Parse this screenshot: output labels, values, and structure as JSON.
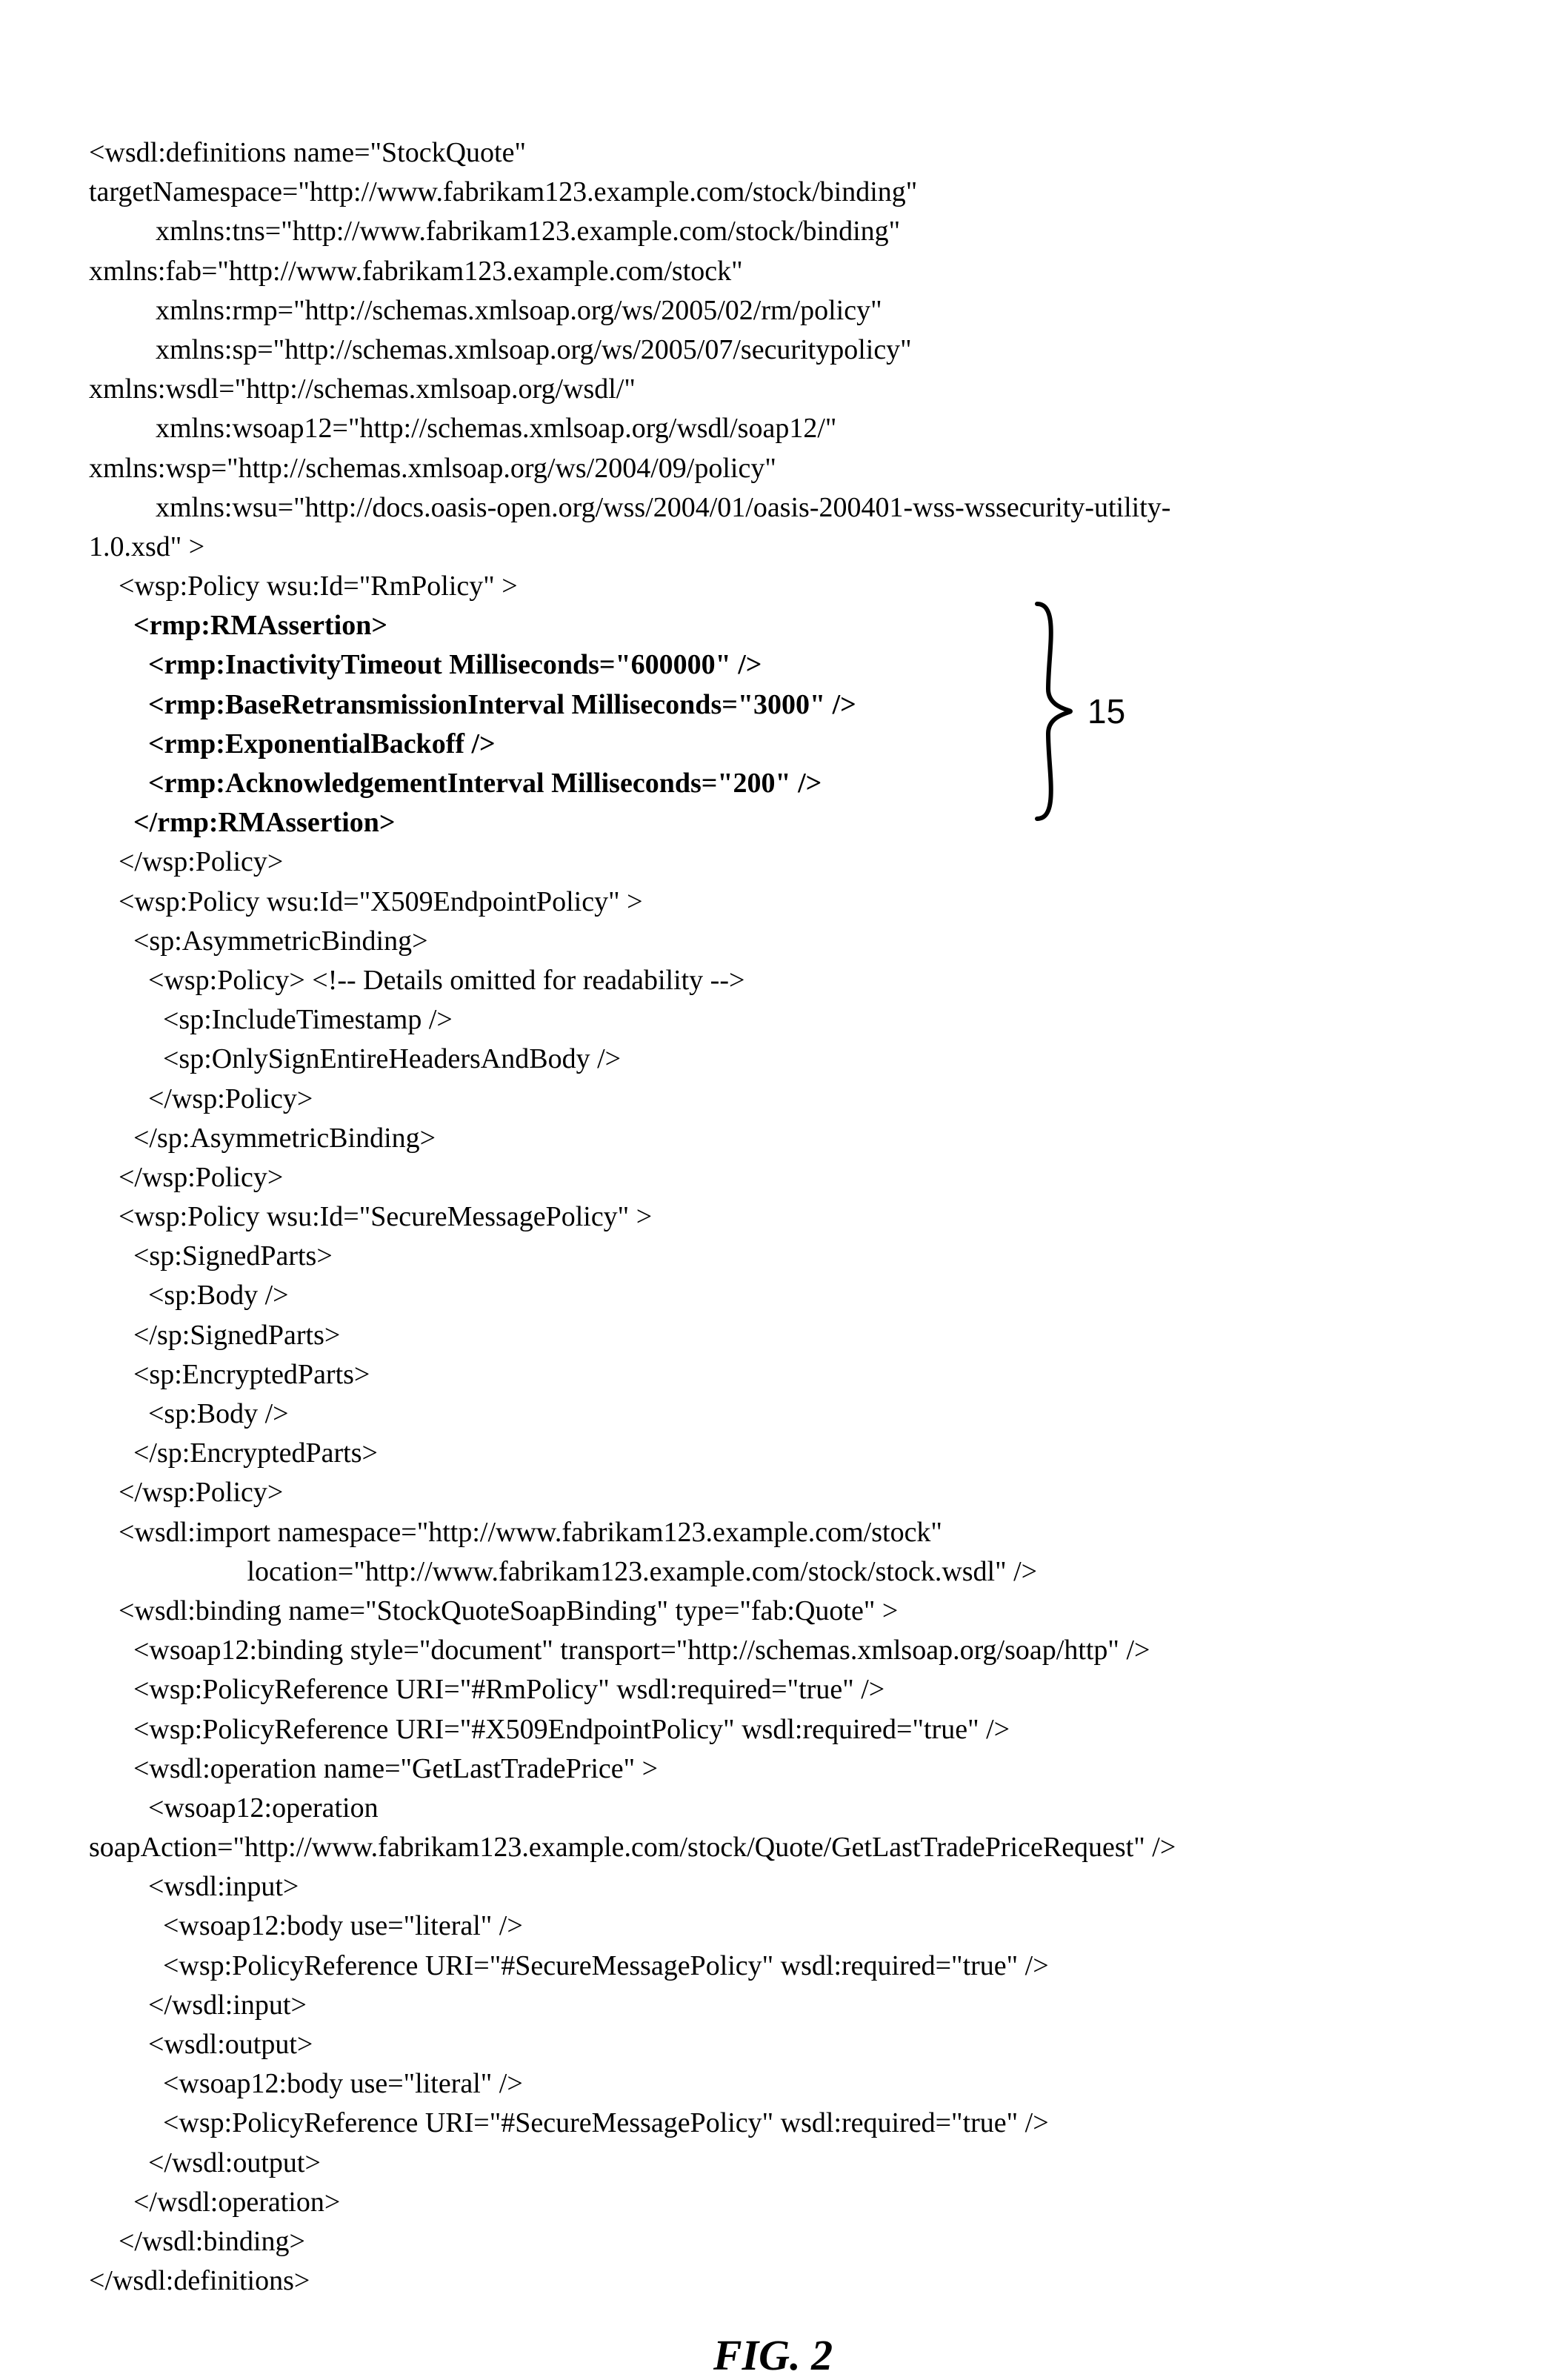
{
  "figure_caption": "FIG. 2",
  "annotation_label": "15",
  "lines": [
    {
      "cls": "",
      "bold": false,
      "text": "<wsdl:definitions name=\"StockQuote\""
    },
    {
      "cls": "",
      "bold": false,
      "text": "targetNamespace=\"http://www.fabrikam123.example.com/stock/binding\""
    },
    {
      "cls": "ind1",
      "bold": false,
      "text": "xmlns:tns=\"http://www.fabrikam123.example.com/stock/binding\""
    },
    {
      "cls": "",
      "bold": false,
      "text": "xmlns:fab=\"http://www.fabrikam123.example.com/stock\""
    },
    {
      "cls": "ind1",
      "bold": false,
      "text": "xmlns:rmp=\"http://schemas.xmlsoap.org/ws/2005/02/rm/policy\""
    },
    {
      "cls": "ind1",
      "bold": false,
      "text": "xmlns:sp=\"http://schemas.xmlsoap.org/ws/2005/07/securitypolicy\""
    },
    {
      "cls": "",
      "bold": false,
      "text": "xmlns:wsdl=\"http://schemas.xmlsoap.org/wsdl/\""
    },
    {
      "cls": "ind1",
      "bold": false,
      "text": "xmlns:wsoap12=\"http://schemas.xmlsoap.org/wsdl/soap12/\""
    },
    {
      "cls": "",
      "bold": false,
      "text": "xmlns:wsp=\"http://schemas.xmlsoap.org/ws/2004/09/policy\""
    },
    {
      "cls": "ind1",
      "bold": false,
      "text": "xmlns:wsu=\"http://docs.oasis-open.org/wss/2004/01/oasis-200401-wss-wssecurity-utility-"
    },
    {
      "cls": "",
      "bold": false,
      "text": "1.0.xsd\" >"
    },
    {
      "cls": "ind2",
      "bold": false,
      "text": "<wsp:Policy wsu:Id=\"RmPolicy\" >"
    },
    {
      "cls": "ind3",
      "bold": true,
      "text": "<rmp:RMAssertion>"
    },
    {
      "cls": "ind4",
      "bold": true,
      "text": "<rmp:InactivityTimeout Milliseconds=\"600000\" />"
    },
    {
      "cls": "ind4",
      "bold": true,
      "text": "<rmp:BaseRetransmissionInterval Milliseconds=\"3000\" />"
    },
    {
      "cls": "ind4",
      "bold": true,
      "text": "<rmp:ExponentialBackoff />"
    },
    {
      "cls": "ind4",
      "bold": true,
      "text": "<rmp:AcknowledgementInterval Milliseconds=\"200\" />"
    },
    {
      "cls": "ind3",
      "bold": true,
      "text": "</rmp:RMAssertion>"
    },
    {
      "cls": "ind2",
      "bold": false,
      "text": "</wsp:Policy>"
    },
    {
      "cls": "ind2",
      "bold": false,
      "text": "<wsp:Policy wsu:Id=\"X509EndpointPolicy\" >"
    },
    {
      "cls": "ind3",
      "bold": false,
      "text": "<sp:AsymmetricBinding>"
    },
    {
      "cls": "ind4",
      "bold": false,
      "text": "<wsp:Policy> <!-- Details omitted for readability -->"
    },
    {
      "cls": "ind5",
      "bold": false,
      "text": "<sp:IncludeTimestamp />"
    },
    {
      "cls": "ind5",
      "bold": false,
      "text": "<sp:OnlySignEntireHeadersAndBody />"
    },
    {
      "cls": "ind4",
      "bold": false,
      "text": "</wsp:Policy>"
    },
    {
      "cls": "ind3",
      "bold": false,
      "text": "</sp:AsymmetricBinding>"
    },
    {
      "cls": "ind2",
      "bold": false,
      "text": "</wsp:Policy>"
    },
    {
      "cls": "ind2",
      "bold": false,
      "text": "<wsp:Policy wsu:Id=\"SecureMessagePolicy\" >"
    },
    {
      "cls": "ind3",
      "bold": false,
      "text": "<sp:SignedParts>"
    },
    {
      "cls": "ind4",
      "bold": false,
      "text": "<sp:Body />"
    },
    {
      "cls": "ind3",
      "bold": false,
      "text": "</sp:SignedParts>"
    },
    {
      "cls": "ind3",
      "bold": false,
      "text": "<sp:EncryptedParts>"
    },
    {
      "cls": "ind4",
      "bold": false,
      "text": "<sp:Body />"
    },
    {
      "cls": "ind3",
      "bold": false,
      "text": "</sp:EncryptedParts>"
    },
    {
      "cls": "ind2",
      "bold": false,
      "text": "</wsp:Policy>"
    },
    {
      "cls": "ind2",
      "bold": false,
      "text": "<wsdl:import namespace=\"http://www.fabrikam123.example.com/stock\""
    },
    {
      "cls": "ind1",
      "bold": false,
      "text": "             location=\"http://www.fabrikam123.example.com/stock/stock.wsdl\" />"
    },
    {
      "cls": "ind2",
      "bold": false,
      "text": "<wsdl:binding name=\"StockQuoteSoapBinding\" type=\"fab:Quote\" >"
    },
    {
      "cls": "ind3",
      "bold": false,
      "text": "<wsoap12:binding style=\"document\" transport=\"http://schemas.xmlsoap.org/soap/http\" />"
    },
    {
      "cls": "ind3",
      "bold": false,
      "text": "<wsp:PolicyReference URI=\"#RmPolicy\" wsdl:required=\"true\" />"
    },
    {
      "cls": "ind3",
      "bold": false,
      "text": "<wsp:PolicyReference URI=\"#X509EndpointPolicy\" wsdl:required=\"true\" />"
    },
    {
      "cls": "ind3",
      "bold": false,
      "text": "<wsdl:operation name=\"GetLastTradePrice\" >"
    },
    {
      "cls": "ind4",
      "bold": false,
      "text": "<wsoap12:operation"
    },
    {
      "cls": "",
      "bold": false,
      "text": "soapAction=\"http://www.fabrikam123.example.com/stock/Quote/GetLastTradePriceRequest\" />"
    },
    {
      "cls": "ind4",
      "bold": false,
      "text": "<wsdl:input>"
    },
    {
      "cls": "ind5",
      "bold": false,
      "text": "<wsoap12:body use=\"literal\" />"
    },
    {
      "cls": "ind5",
      "bold": false,
      "text": "<wsp:PolicyReference URI=\"#SecureMessagePolicy\" wsdl:required=\"true\" />"
    },
    {
      "cls": "ind4",
      "bold": false,
      "text": "</wsdl:input>"
    },
    {
      "cls": "ind4",
      "bold": false,
      "text": "<wsdl:output>"
    },
    {
      "cls": "ind5",
      "bold": false,
      "text": "<wsoap12:body use=\"literal\" />"
    },
    {
      "cls": "ind5",
      "bold": false,
      "text": "<wsp:PolicyReference URI=\"#SecureMessagePolicy\" wsdl:required=\"true\" />"
    },
    {
      "cls": "ind4",
      "bold": false,
      "text": "</wsdl:output>"
    },
    {
      "cls": "ind3",
      "bold": false,
      "text": "</wsdl:operation>"
    },
    {
      "cls": "ind2",
      "bold": false,
      "text": "</wsdl:binding>"
    },
    {
      "cls": "",
      "bold": false,
      "text": "</wsdl:definitions>"
    }
  ]
}
